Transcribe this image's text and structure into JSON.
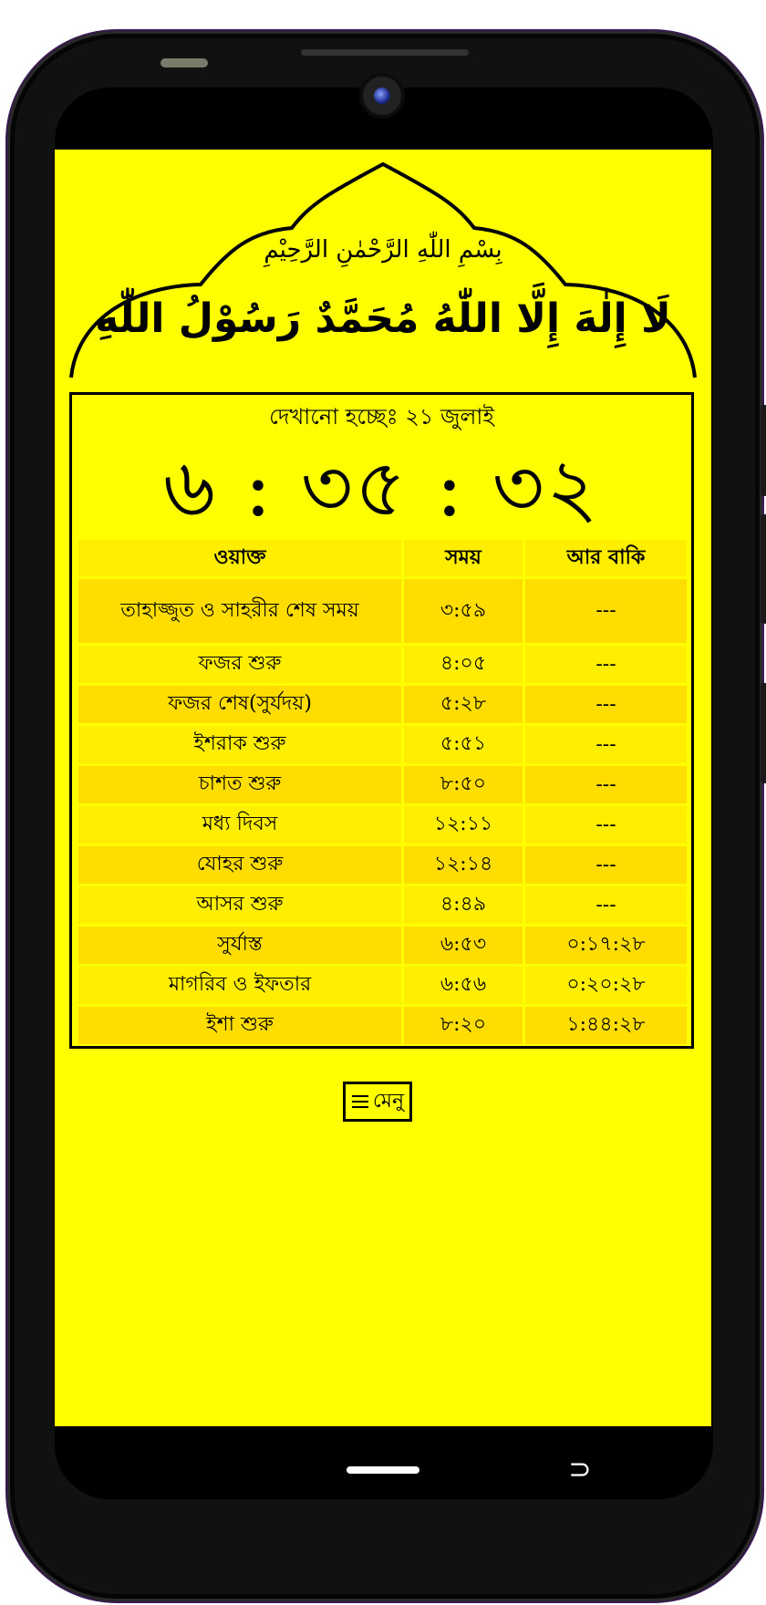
{
  "header": {
    "bismillah": "بِسْمِ اللّٰهِ الرَّحْمٰنِ الرَّحِيْمِ",
    "kalima": "لَا إِلٰهَ إِلَّا اللّٰهُ مُحَمَّدٌ رَسُوْلُ اللّٰهِ"
  },
  "status": {
    "showing": "দেখানো হচ্ছেঃ ২১ জুলাই",
    "clock": "৬ : ৩৫ : ৩২"
  },
  "table": {
    "headers": [
      "ওয়াক্ত",
      "সময়",
      "আর বাকি"
    ],
    "rows": [
      {
        "name": "তাহাজ্জুত ও সাহরীর শেষ সময়",
        "time": "৩:৫৯",
        "remaining": "---"
      },
      {
        "name": "ফজর শুরু",
        "time": "৪:০৫",
        "remaining": "---"
      },
      {
        "name": "ফজর শেষ(সুর্যদয়)",
        "time": "৫:২৮",
        "remaining": "---"
      },
      {
        "name": "ইশরাক শুরু",
        "time": "৫:৫১",
        "remaining": "---"
      },
      {
        "name": "চাশত শুরু",
        "time": "৮:৫০",
        "remaining": "---"
      },
      {
        "name": "মধ্য দিবস",
        "time": "১২:১১",
        "remaining": "---"
      },
      {
        "name": "যোহর শুরু",
        "time": "১২:১৪",
        "remaining": "---"
      },
      {
        "name": "আসর শুরু",
        "time": "৪:৪৯",
        "remaining": "---"
      },
      {
        "name": "সুর্যাস্ত",
        "time": "৬:৫৩",
        "remaining": "০:১৭:২৮"
      },
      {
        "name": "মাগরিব ও ইফতার",
        "time": "৬:৫৬",
        "remaining": "০:২০:২৮"
      },
      {
        "name": "ইশা শুরু",
        "time": "৮:২০",
        "remaining": "১:৪৪:২৮"
      }
    ]
  },
  "menu": {
    "icon": "hamburger-icon",
    "label": "মেনু"
  },
  "colors": {
    "background": "#ffff00",
    "row_light": "#ffee00",
    "row_dark": "#ffdd00",
    "text": "#000000"
  }
}
